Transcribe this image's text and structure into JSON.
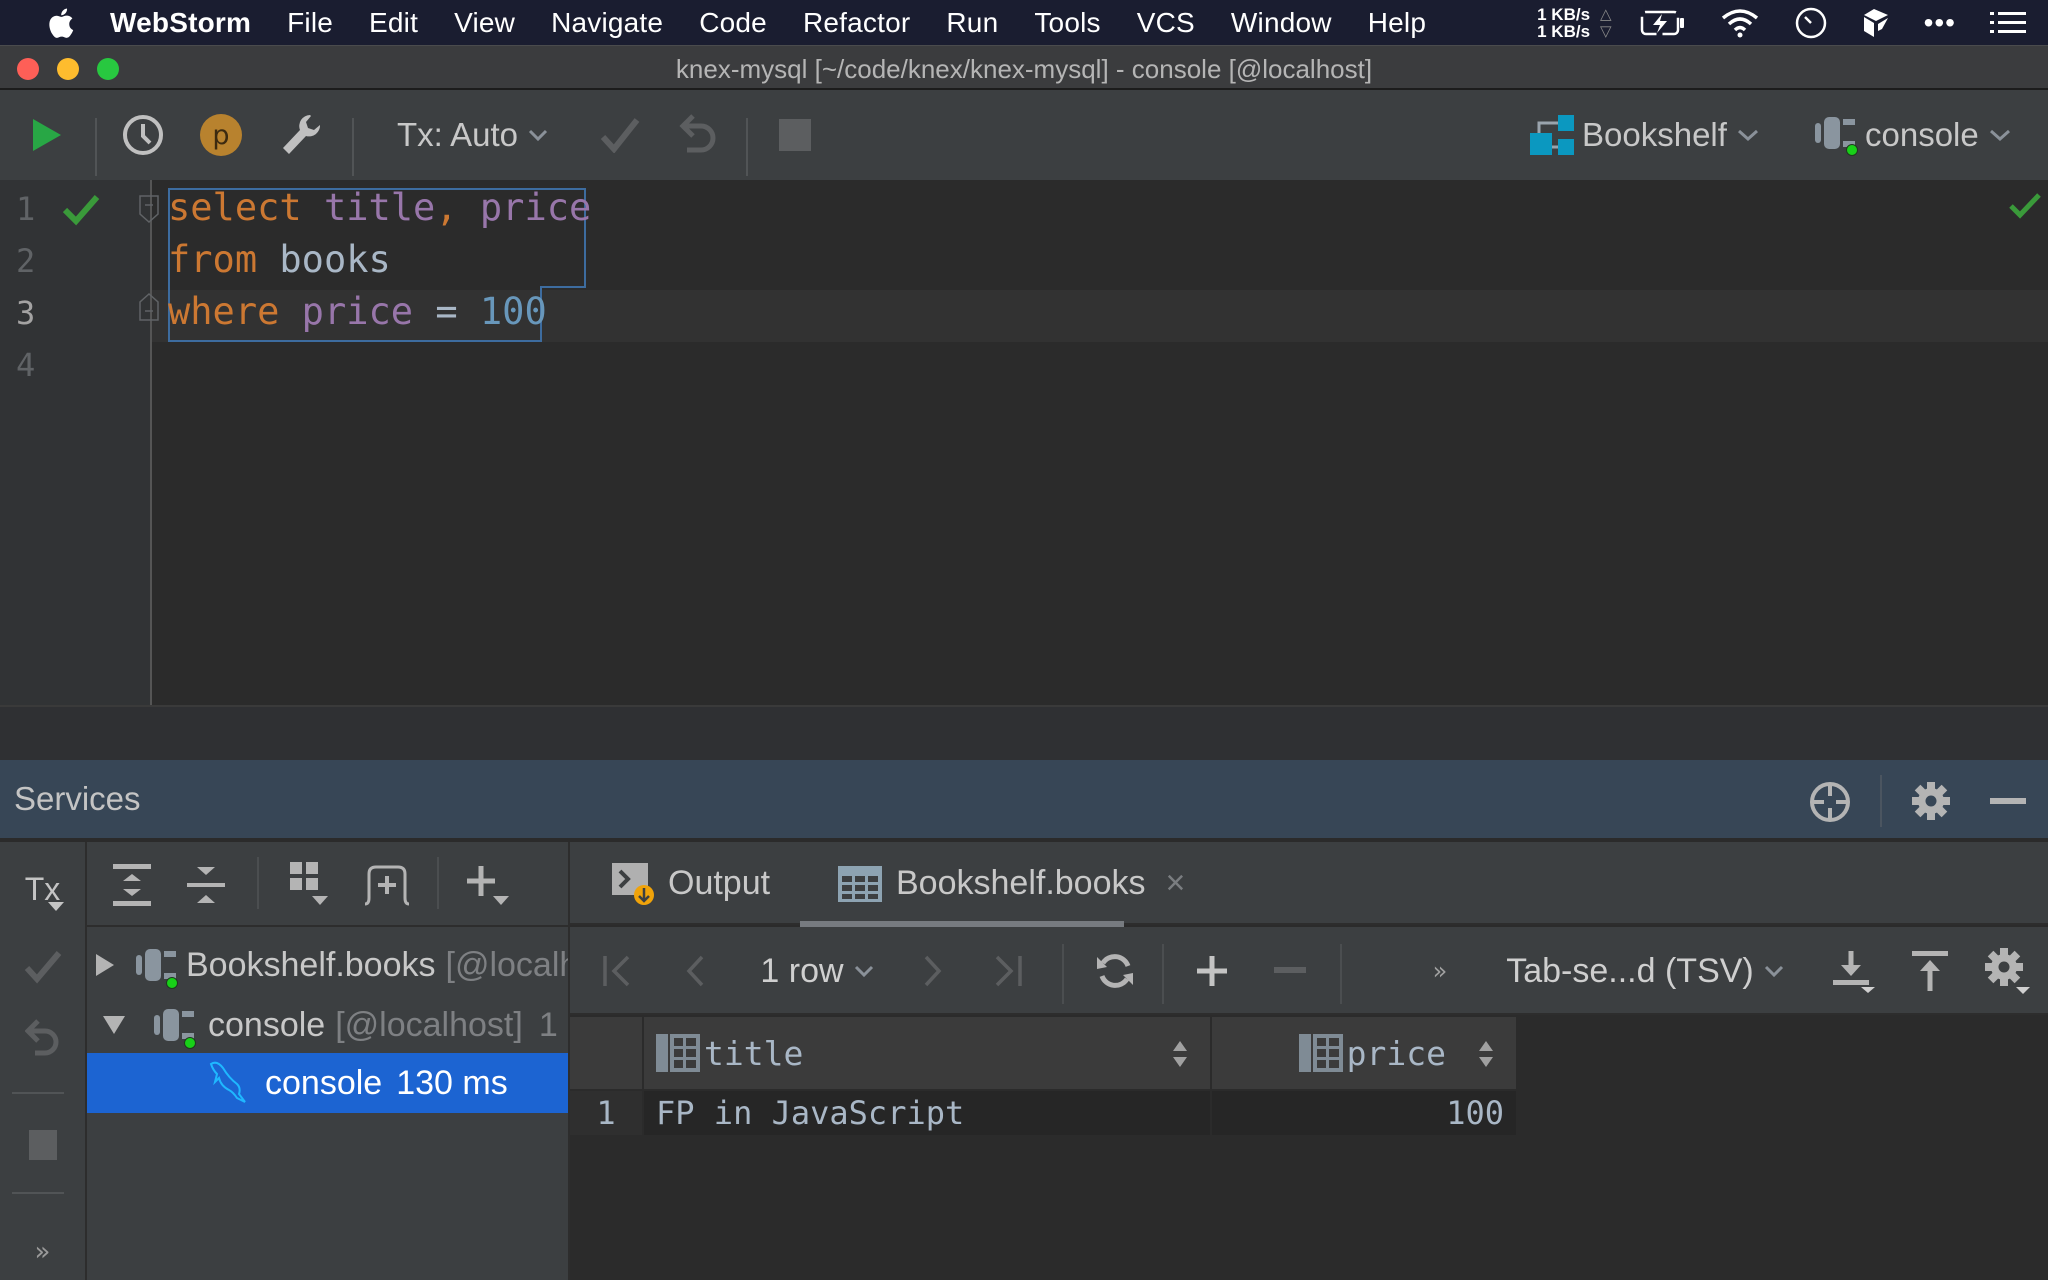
{
  "menubar": {
    "app_name": "WebStorm",
    "items": [
      "File",
      "Edit",
      "View",
      "Navigate",
      "Code",
      "Refactor",
      "Run",
      "Tools",
      "VCS",
      "Window",
      "Help"
    ],
    "net_up": "1 KB/s",
    "net_down": "1 KB/s",
    "status_icons": [
      "battery-charging-icon",
      "wifi-icon",
      "clock-icon",
      "dropbox-icon",
      "more-icon",
      "list-icon"
    ]
  },
  "window": {
    "title": "knex-mysql [~/code/knex/knex-mysql] - console [@localhost]"
  },
  "toolbar": {
    "tx_mode": "Tx: Auto",
    "datasource": "Bookshelf",
    "session": "console",
    "icons": [
      "execute-icon",
      "history-icon",
      "profile-p-icon",
      "settings-wrench-icon",
      "commit-icon",
      "rollback-icon",
      "stop-icon"
    ]
  },
  "editor": {
    "line_numbers": [
      "1",
      "2",
      "3",
      "4"
    ],
    "current_line": 3,
    "lines": [
      [
        {
          "t": "select",
          "c": "kw"
        },
        {
          "t": " ",
          "c": "op"
        },
        {
          "t": "title",
          "c": "col"
        },
        {
          "t": ",",
          "c": "kw"
        },
        {
          "t": " ",
          "c": "op"
        },
        {
          "t": "price",
          "c": "col"
        }
      ],
      [
        {
          "t": "from",
          "c": "kw"
        },
        {
          "t": " ",
          "c": "op"
        },
        {
          "t": "books",
          "c": "tbl"
        }
      ],
      [
        {
          "t": "where",
          "c": "kw"
        },
        {
          "t": " ",
          "c": "op"
        },
        {
          "t": "price",
          "c": "col"
        },
        {
          "t": " = ",
          "c": "op"
        },
        {
          "t": "100",
          "c": "num"
        }
      ],
      []
    ],
    "executed_ok": true
  },
  "services": {
    "title": "Services",
    "header_icons": [
      "target-icon",
      "gear-icon",
      "minimize-icon"
    ],
    "vertical_tools": {
      "tx_label": "Tx",
      "more_label": "»"
    },
    "tree": [
      {
        "name": "Bookshelf.books",
        "host": "[@localhost]",
        "expanded": false,
        "level": 0,
        "selected": false
      },
      {
        "name": "console",
        "host": "[@localhost]",
        "suffix": "1",
        "expanded": true,
        "level": 0,
        "selected": false
      },
      {
        "name": "console",
        "time": "130 ms",
        "level": 1,
        "selected": true
      }
    ]
  },
  "results": {
    "tabs": [
      {
        "label": "Output",
        "active": false
      },
      {
        "label": "Bookshelf.books",
        "active": true,
        "closable": true
      }
    ],
    "close_glyph": "×",
    "row_count_label": "1 row",
    "overflow_label": "»",
    "export_format": "Tab-se...d (TSV)",
    "columns": [
      "title",
      "price"
    ],
    "rows": [
      {
        "num": "1",
        "title": "FP in JavaScript",
        "price": "100"
      }
    ]
  },
  "colors": {
    "accent_selection": "#1c64d2",
    "keyword": "#cc7832",
    "column": "#9876aa",
    "number": "#6897bb",
    "ok_green": "#3a9a3a",
    "services_header": "#374656"
  }
}
